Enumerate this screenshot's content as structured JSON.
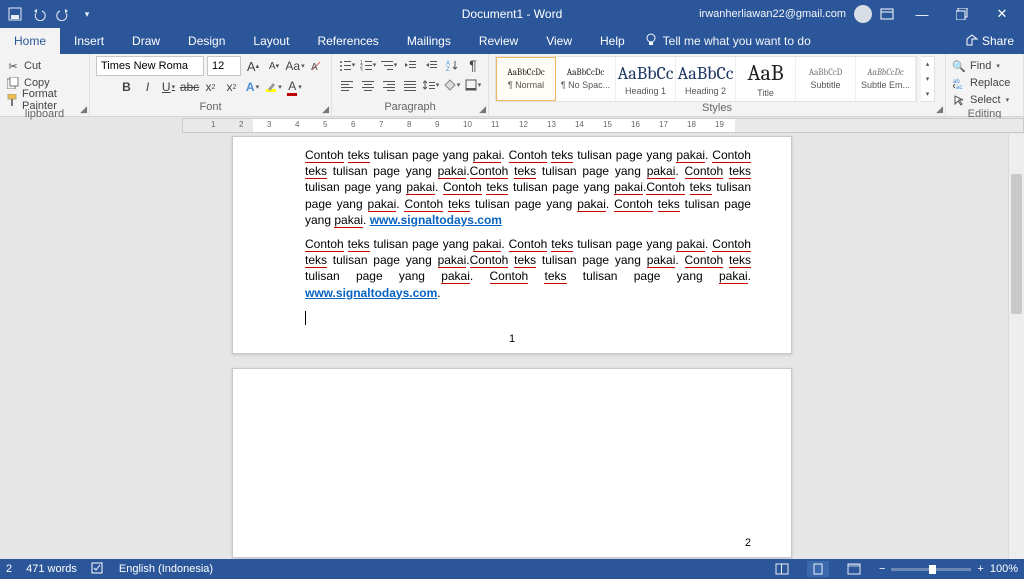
{
  "title": "Document1 - Word",
  "user_email": "irwanherliawan22@gmail.com",
  "tabs": [
    "Home",
    "Insert",
    "Draw",
    "Design",
    "Layout",
    "References",
    "Mailings",
    "Review",
    "View",
    "Help"
  ],
  "active_tab": 0,
  "tellme": "Tell me what you want to do",
  "share": "Share",
  "clipboard": {
    "cut": "Cut",
    "copy": "Copy",
    "painter": "Format Painter",
    "label": "lipboard"
  },
  "font": {
    "name": "Times New Roma",
    "size": "12",
    "label": "Font"
  },
  "paragraph": {
    "label": "Paragraph"
  },
  "style_items": [
    {
      "preview": "AaBbCcDc",
      "name": "¶ Normal",
      "cls": ""
    },
    {
      "preview": "AaBbCcDc",
      "name": "¶ No Spac...",
      "cls": ""
    },
    {
      "preview": "AaBbCc",
      "name": "Heading 1",
      "cls": "big"
    },
    {
      "preview": "AaBbCc",
      "name": "Heading 2",
      "cls": "big"
    },
    {
      "preview": "AaB",
      "name": "Title",
      "cls": "title"
    },
    {
      "preview": "AaBbCcD",
      "name": "Subtitle",
      "cls": ""
    },
    {
      "preview": "AaBbCcDc",
      "name": "Subtle Em...",
      "cls": ""
    }
  ],
  "styles_label": "Styles",
  "editing": {
    "find": "Find",
    "replace": "Replace",
    "select": "Select",
    "label": "Editing"
  },
  "ruler": [
    "",
    "1",
    "2",
    "3",
    "4",
    "5",
    "6",
    "7",
    "8",
    "9",
    "10",
    "11",
    "12",
    "13",
    "14",
    "15",
    "16",
    "17",
    "18",
    "19"
  ],
  "doc": {
    "p1a": "Contoh teks tulisan page yang pakai. Contoh teks tulisan page yang pakai. Contoh teks tulisan page yang pakai.Contoh teks tulisan page yang pakai. Contoh teks tulisan page yang pakai. Contoh teks tulisan page yang pakai.Contoh teks tulisan page yang pakai. Contoh teks tulisan page yang pakai. Contoh teks tulisan page yang pakai. ",
    "link": "www.signaltodays.com",
    "p2a": "Contoh teks tulisan page yang pakai. Contoh teks tulisan page yang pakai. Contoh teks tulisan page yang pakai.Contoh teks tulisan page yang pakai. Contoh teks tulisan page yang pakai. Contoh teks tulisan page yang pakai. ",
    "link2": "www.signaltodays.com",
    "pageno1": "1",
    "pageno2": "2"
  },
  "status": {
    "page": "2",
    "words": "471 words",
    "lang": "English (Indonesia)",
    "zoom": "100%"
  }
}
